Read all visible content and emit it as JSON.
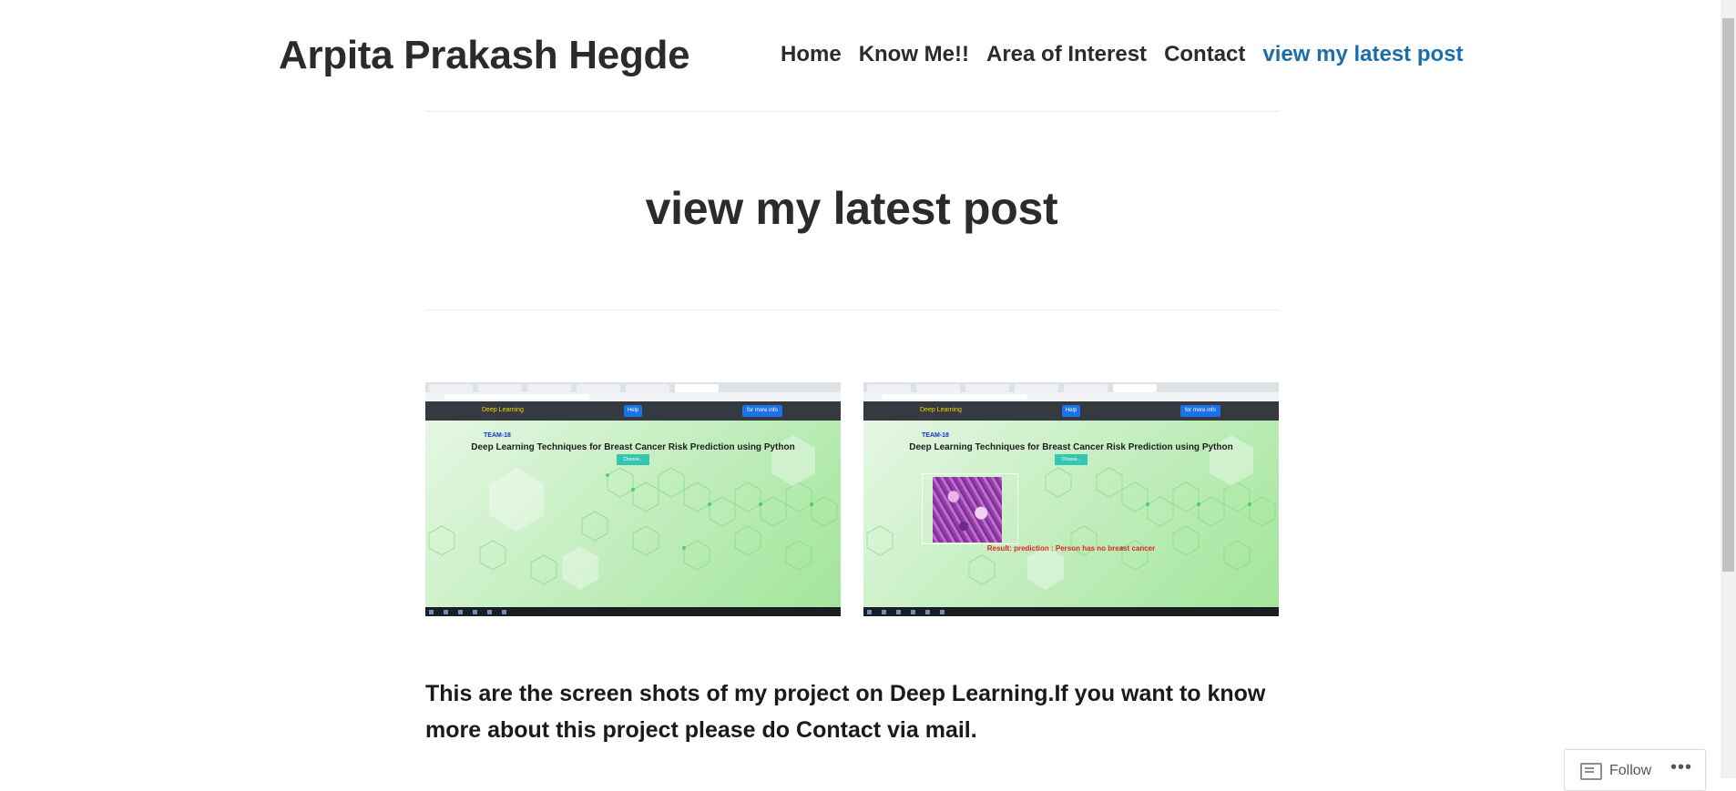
{
  "site": {
    "title": "Arpita Prakash Hegde"
  },
  "nav": {
    "items": [
      {
        "label": "Home"
      },
      {
        "label": "Know Me!!"
      },
      {
        "label": "Area of Interest"
      },
      {
        "label": "Contact"
      },
      {
        "label": "view my latest post"
      }
    ],
    "current_color": "#1a6faa"
  },
  "page": {
    "title": "view my latest post"
  },
  "gallery": [
    {
      "brand": "Deep Learning",
      "help_label": "Help",
      "info_label": "for more info",
      "team": "TEAM-18",
      "project_title": "Deep Learning Techniques for Breast Cancer Risk Prediction using Python",
      "choose_label": "Choose..."
    },
    {
      "brand": "Deep Learning",
      "help_label": "Help",
      "info_label": "for more info",
      "team": "TEAM-18",
      "project_title": "Deep Learning Techniques for Breast Cancer Risk Prediction using Python",
      "choose_label": "Choose...",
      "result": "Result: prediction : Person has no breast cancer"
    }
  ],
  "content": {
    "paragraph": "This are the screen shots of my project on Deep Learning.If you want to know more about this project please do Contact via mail."
  },
  "follow": {
    "label": "Follow",
    "more": "•••"
  }
}
